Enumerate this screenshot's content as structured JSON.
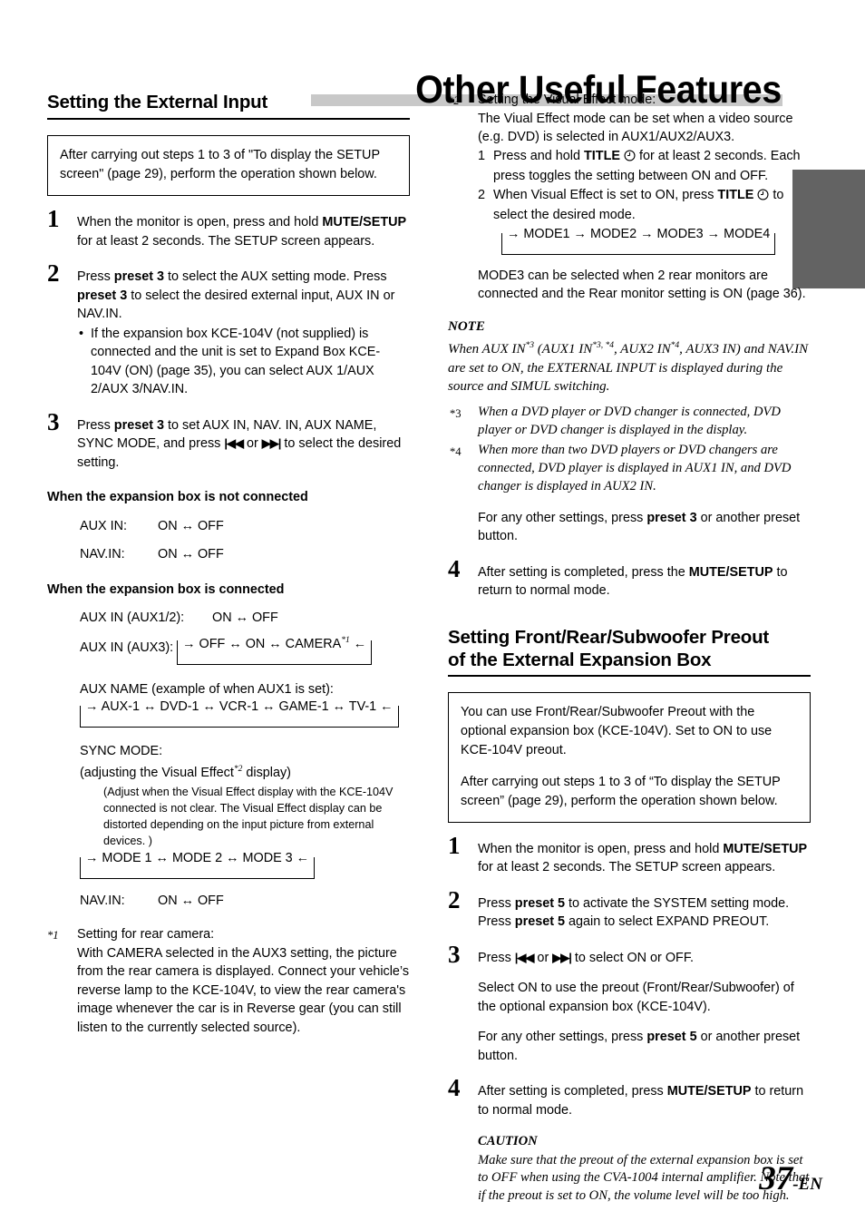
{
  "page": {
    "title": "Other Useful Features",
    "number": "37",
    "number_suffix": "-EN"
  },
  "left_column": {
    "heading": "Setting the External Input",
    "callout": "After carrying out steps 1 to 3 of \"To display the SETUP screen\" (page 29), perform the operation shown below.",
    "steps": [
      {
        "num": "1",
        "text_a": "When the monitor is open, press and hold ",
        "bold_a": "MUTE/SETUP",
        "text_b": " for at least 2 seconds. The SETUP screen appears."
      },
      {
        "num": "2",
        "line1_a": "Press ",
        "line1_bold": "preset 3",
        "line1_b": " to select the AUX setting mode. Press ",
        "line1_bold2": "preset 3",
        "line1_c": " to select the desired external input, AUX IN or NAV.IN.",
        "bullet": "If the expansion box KCE-104V (not supplied) is connected and the unit is set to Expand Box KCE-104V (ON) (page 35), you can select AUX 1/AUX 2/AUX 3/NAV.IN."
      },
      {
        "num": "3",
        "text_a": "Press ",
        "bold_a": "preset 3",
        "text_b": " to set AUX IN, NAV. IN, AUX NAME, SYNC MODE, and press ",
        "btn_prev": "|◀◀",
        "text_c": " or ",
        "btn_next": "▶▶|",
        "text_d": " to select the desired setting."
      }
    ],
    "not_connected": {
      "heading": "When the expansion box is not connected",
      "rows": [
        {
          "label": "AUX IN:",
          "value": "ON ↔ OFF"
        },
        {
          "label": "NAV.IN:",
          "value": "ON ↔ OFF"
        }
      ]
    },
    "connected": {
      "heading": "When the expansion box is connected",
      "aux12_label": "AUX IN (AUX1/2):",
      "aux12_value": "ON ↔ OFF",
      "aux3_label": "AUX IN (AUX3):",
      "aux3_cycle": "→ OFF ↔ ON ↔ CAMERA",
      "aux3_cycle_footnote": "*1",
      "aux3_cycle_end": "←",
      "auxname_label": "AUX NAME (example of when AUX1 is set):",
      "auxname_cycle": "→ AUX-1 ↔ DVD-1 ↔ VCR-1 ↔ GAME-1 ↔ TV-1 ←",
      "sync_label": "SYNC MODE:",
      "sync_sub_a": "(adjusting the Visual Effect",
      "sync_sub_footnote": "*2",
      "sync_sub_b": " display)",
      "sync_note": "(Adjust when the Visual Effect display with the KCE-104V connected is not clear. The Visual Effect display can be distorted depending on the input picture from external devices. )",
      "sync_cycle": "→ MODE 1 ↔ MODE 2 ↔ MODE 3 ←",
      "navin_label": "NAV.IN:",
      "navin_value": "ON ↔ OFF"
    },
    "footnote1": {
      "mark": "*1",
      "title": "Setting for rear camera:",
      "text": "With CAMERA selected in the AUX3 setting, the picture from the rear camera is displayed. Connect your vehicle’s reverse lamp to the KCE-104V, to view the rear camera's image whenever the car is in Reverse gear (you can still listen to the currently selected source)."
    }
  },
  "right_column": {
    "footnote2": {
      "mark": "*2",
      "title": "Setting the Visual Effect mode:",
      "intro": "The Viual Effect mode can be set when a video source (e.g. DVD) is selected in AUX1/AUX2/AUX3.",
      "sub1_num": "1",
      "sub1_a": "Press and hold ",
      "sub1_bold": "TITLE",
      "sub1_icon": "clock-icon",
      "sub1_b": " for at least 2 seconds. Each press toggles the setting between ON and OFF.",
      "sub2_num": "2",
      "sub2_a": "When Visual Effect is set to ON, press ",
      "sub2_bold": "TITLE",
      "sub2_icon": "clock-icon",
      "sub2_b": " to select the desired mode.",
      "mode_cycle": "→ MODE1 → MODE2 → MODE3 → MODE4",
      "mode3_note": "MODE3 can be selected when 2 rear monitors are connected and the Rear monitor setting is ON (page 36)."
    },
    "note": {
      "heading": "NOTE",
      "text_a": "When AUX IN",
      "sup_a": "*3",
      "text_b": " (AUX1 IN",
      "sup_b": "*3, *4",
      "text_c": ", AUX2 IN",
      "sup_c": "*4",
      "text_d": ", AUX3 IN) and NAV.IN are set to ON, the EXTERNAL INPUT is displayed during the source and SIMUL switching."
    },
    "footnote3": {
      "mark": "*3",
      "text": "When a DVD player or DVD changer is connected, DVD player or DVD changer is displayed in the display."
    },
    "footnote4": {
      "mark": "*4",
      "text": "When more than two DVD players or DVD changers are connected, DVD player is displayed in AUX1 IN, and DVD changer is displayed in AUX2 IN."
    },
    "other_settings": {
      "text_a": "For any other settings, press ",
      "bold": "preset 3",
      "text_b": " or another preset button."
    },
    "step4": {
      "num": "4",
      "text_a": "After setting is completed, press the ",
      "bold": "MUTE/SETUP",
      "text_b": " to return to normal mode."
    },
    "heading2_line1": "Setting Front/Rear/Subwoofer Preout",
    "heading2_line2": "of the External Expansion Box",
    "callout2_p1": "You can use Front/Rear/Subwoofer Preout with the optional expansion box (KCE-104V). Set to ON to use KCE-104V preout.",
    "callout2_p2": "After carrying out steps 1 to 3 of “To display the SETUP screen” (page 29), perform the operation shown below.",
    "steps2": [
      {
        "num": "1",
        "text_a": "When the monitor is open, press and hold ",
        "bold_a": "MUTE/SETUP",
        "text_b": " for at least 2 seconds. The SETUP screen appears."
      },
      {
        "num": "2",
        "text_a": "Press ",
        "bold_a": "preset 5",
        "text_b": " to activate the SYSTEM setting mode. Press ",
        "bold_b": "preset 5",
        "text_c": " again to select EXPAND PREOUT."
      },
      {
        "num": "3",
        "text_a": "Press ",
        "btn_prev": "|◀◀",
        "text_b": " or ",
        "btn_next": "▶▶|",
        "text_c": " to select ON or OFF.",
        "para2": "Select ON to use the preout (Front/Rear/Subwoofer) of the optional expansion box (KCE-104V).",
        "para3_a": "For any other settings, press ",
        "para3_bold": "preset 5",
        "para3_b": " or another preset button."
      },
      {
        "num": "4",
        "text_a": "After setting is completed, press ",
        "bold_a": "MUTE/SETUP",
        "text_b": " to return to normal mode."
      }
    ],
    "caution": {
      "heading": "CAUTION",
      "text": "Make sure that the preout of the external expansion box is set to OFF when using the CVA-1004 internal amplifier. Note that if the preout is set to ON, the volume level will be too high."
    }
  },
  "colors": {
    "title_bar": "#c8c8c8",
    "side_tab": "#636363"
  }
}
